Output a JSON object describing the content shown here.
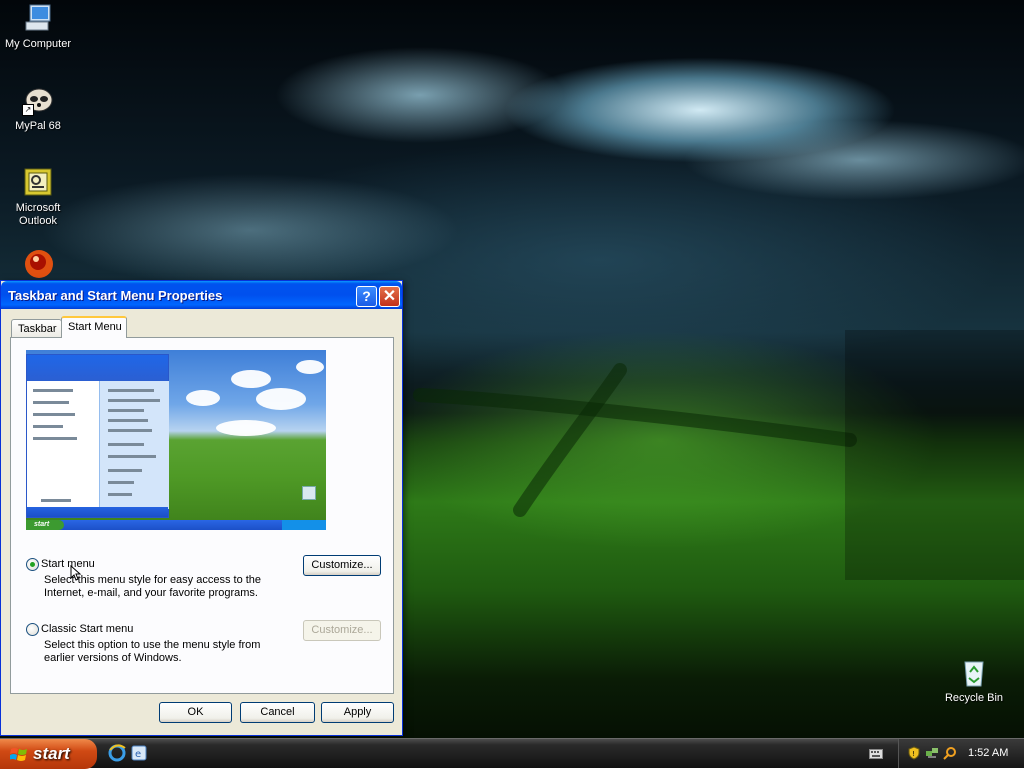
{
  "desktop": {
    "icons": [
      {
        "label": "My Computer",
        "icon": "my-computer-icon"
      },
      {
        "label": "MyPal 68",
        "icon": "mypal-icon"
      },
      {
        "label": "Microsoft Outlook",
        "icon": "outlook-icon"
      },
      {
        "label": "",
        "icon": "app-shortcut-icon"
      },
      {
        "label": "Recycle Bin",
        "icon": "recycle-bin-icon"
      }
    ]
  },
  "dialog": {
    "title": "Taskbar and Start Menu Properties",
    "tabs": [
      {
        "label": "Taskbar",
        "active": false
      },
      {
        "label": "Start Menu",
        "active": true
      }
    ],
    "preview": {
      "start_label": "start"
    },
    "options": [
      {
        "label": "Start menu",
        "description": "Select this menu style for easy access to the Internet, e-mail, and your favorite programs.",
        "checked": true,
        "customize_label": "Customize...",
        "customize_enabled": true
      },
      {
        "label": "Classic Start menu",
        "description": "Select this option to use the menu style from earlier versions of Windows.",
        "checked": false,
        "customize_label": "Customize...",
        "customize_enabled": false
      }
    ],
    "buttons": {
      "ok": "OK",
      "cancel": "Cancel",
      "apply": "Apply"
    }
  },
  "taskbar": {
    "start_label": "start",
    "quick_launch": [
      "internet-explorer-icon",
      "outlook-express-icon"
    ],
    "tray_icons": [
      "security-shield-icon",
      "network-icon",
      "search-icon"
    ],
    "clock": "1:52 AM"
  },
  "colors": {
    "title_blue": "#0053ee",
    "dialog_bg": "#ece9d8",
    "start_orange": "#d04a14",
    "taskbar_dark": "#1e1e1e"
  }
}
